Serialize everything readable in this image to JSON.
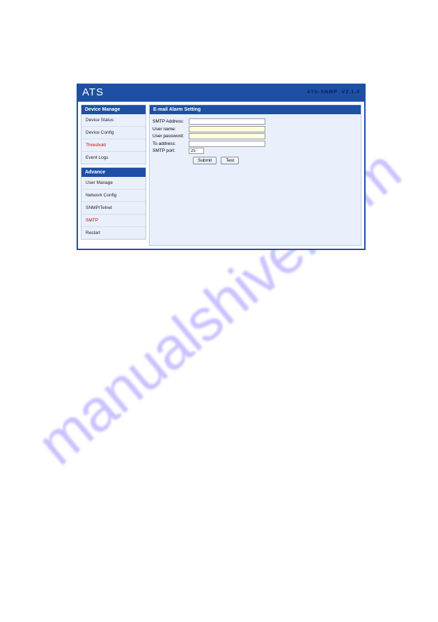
{
  "watermark": "manualshive.com",
  "titlebar": {
    "brand": "ATS",
    "model": "ATS-SNMP",
    "version": "V2.1.0"
  },
  "sidebar": {
    "device_manage": {
      "heading": "Device Manage",
      "items": [
        "Device Status",
        "Device Config",
        "Threshold",
        "Event Logs"
      ],
      "activeIndex": 2
    },
    "advance": {
      "heading": "Advance",
      "items": [
        "User Manage",
        "Network Config",
        "SNMP/Telnet",
        "SMTP",
        "Restart"
      ],
      "activeIndex": 3
    }
  },
  "panel": {
    "heading": "E-mail Alarm Setting",
    "labels": {
      "smtp_address": "SMTP Address:",
      "user_name": "User name:",
      "user_password": "User password:",
      "to_address": "To address:",
      "smtp_port": "SMTP port:"
    },
    "values": {
      "smtp_address": "",
      "user_name": "",
      "user_password": "",
      "to_address": "",
      "smtp_port": "25"
    },
    "buttons": {
      "submit": "Submit",
      "test": "Test"
    }
  }
}
